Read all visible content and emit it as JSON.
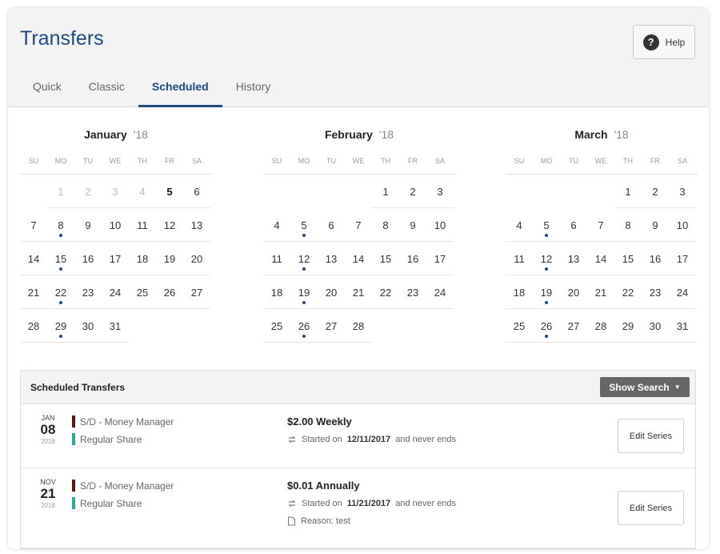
{
  "page": {
    "title": "Transfers",
    "help_label": "Help"
  },
  "tabs": [
    {
      "label": "Quick"
    },
    {
      "label": "Classic"
    },
    {
      "label": "Scheduled",
      "active": true
    },
    {
      "label": "History"
    }
  ],
  "weekdays": [
    "SU",
    "MO",
    "TU",
    "WE",
    "TH",
    "FR",
    "SA"
  ],
  "calendars": [
    {
      "month": "January",
      "year": "'18",
      "first_weekday": 1,
      "days": 31,
      "past_days": [
        1,
        2,
        3,
        4
      ],
      "today": 5,
      "scheduled": [
        8,
        15,
        22,
        29
      ]
    },
    {
      "month": "February",
      "year": "'18",
      "first_weekday": 4,
      "days": 28,
      "past_days": [],
      "today": null,
      "scheduled": [
        5,
        12,
        19,
        26
      ]
    },
    {
      "month": "March",
      "year": "'18",
      "first_weekday": 4,
      "days": 31,
      "past_days": [],
      "today": null,
      "scheduled": [
        5,
        12,
        19,
        26
      ]
    }
  ],
  "scheduled": {
    "title": "Scheduled Transfers",
    "show_search_label": "Show Search",
    "items": [
      {
        "month": "JAN",
        "day": "08",
        "year": "2018",
        "from": "S/D - Money Manager",
        "to": "Regular Share",
        "amount": "$2.00 Weekly",
        "started_prefix": "Started on",
        "started_date": "12/11/2017",
        "started_suffix": "and never ends",
        "reason": "",
        "edit_label": "Edit Series"
      },
      {
        "month": "NOV",
        "day": "21",
        "year": "2018",
        "from": "S/D - Money Manager",
        "to": "Regular Share",
        "amount": "$0.01 Annually",
        "started_prefix": "Started on",
        "started_date": "11/21/2017",
        "started_suffix": "and never ends",
        "reason": "Reason: test",
        "edit_label": "Edit Series"
      }
    ]
  },
  "colors": {
    "accent": "#1e4a80",
    "from_account": "#5a1a10",
    "to_account": "#2aa89a",
    "button_dark": "#666666"
  },
  "icons": {
    "help": "question-circle-icon",
    "caret": "caret-down-icon",
    "repeat": "repeat-icon",
    "note": "note-icon"
  }
}
